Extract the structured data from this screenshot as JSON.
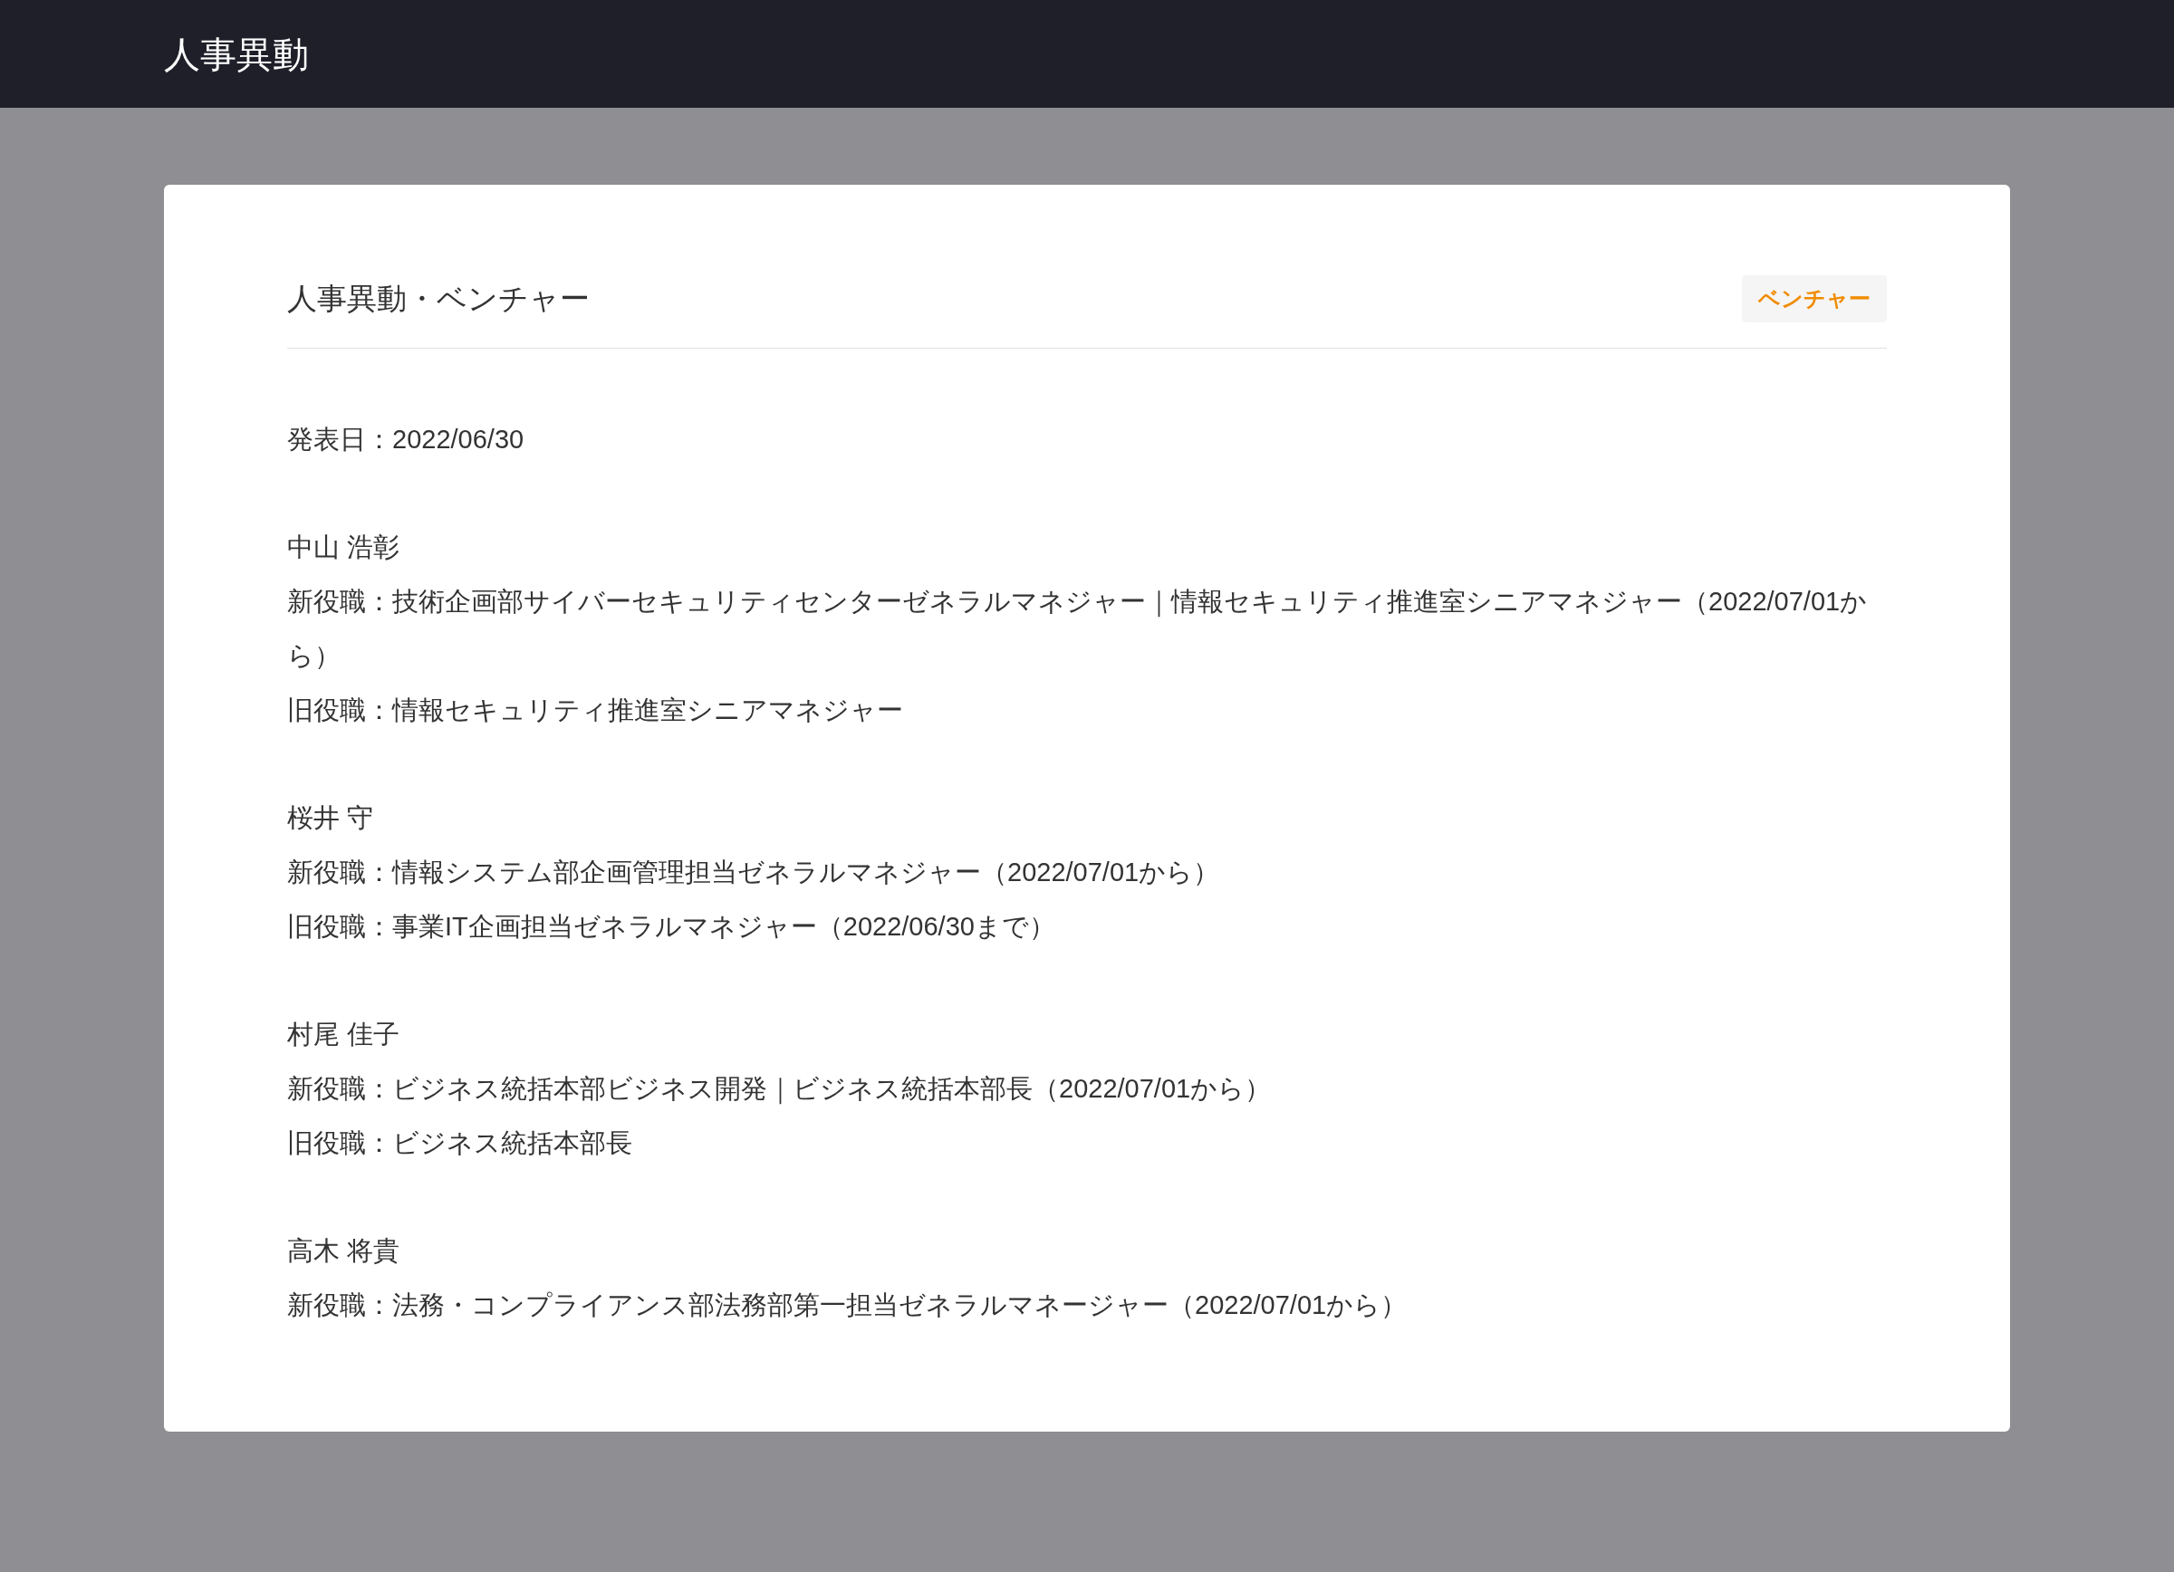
{
  "header": {
    "title": "人事異動"
  },
  "card": {
    "title": "人事異動・ベンチャー",
    "badge": "ベンチャー",
    "announcement": "発表日：2022/06/30",
    "people": [
      {
        "name": "中山 浩彰",
        "lines": [
          "新役職：技術企画部サイバーセキュリティセンターゼネラルマネジャー｜情報セキュリティ推進室シニアマネジャー（2022/07/01から）",
          "旧役職：情報セキュリティ推進室シニアマネジャー"
        ]
      },
      {
        "name": "桜井 守",
        "lines": [
          "新役職：情報システム部企画管理担当ゼネラルマネジャー（2022/07/01から）",
          "旧役職：事業IT企画担当ゼネラルマネジャー（2022/06/30まで）"
        ]
      },
      {
        "name": "村尾 佳子",
        "lines": [
          "新役職：ビジネス統括本部ビジネス開発｜ビジネス統括本部長（2022/07/01から）",
          "旧役職：ビジネス統括本部長"
        ]
      },
      {
        "name": "高木 将貴",
        "lines": [
          "新役職：法務・コンプライアンス部法務部第一担当ゼネラルマネージャー（2022/07/01から）"
        ]
      }
    ]
  }
}
